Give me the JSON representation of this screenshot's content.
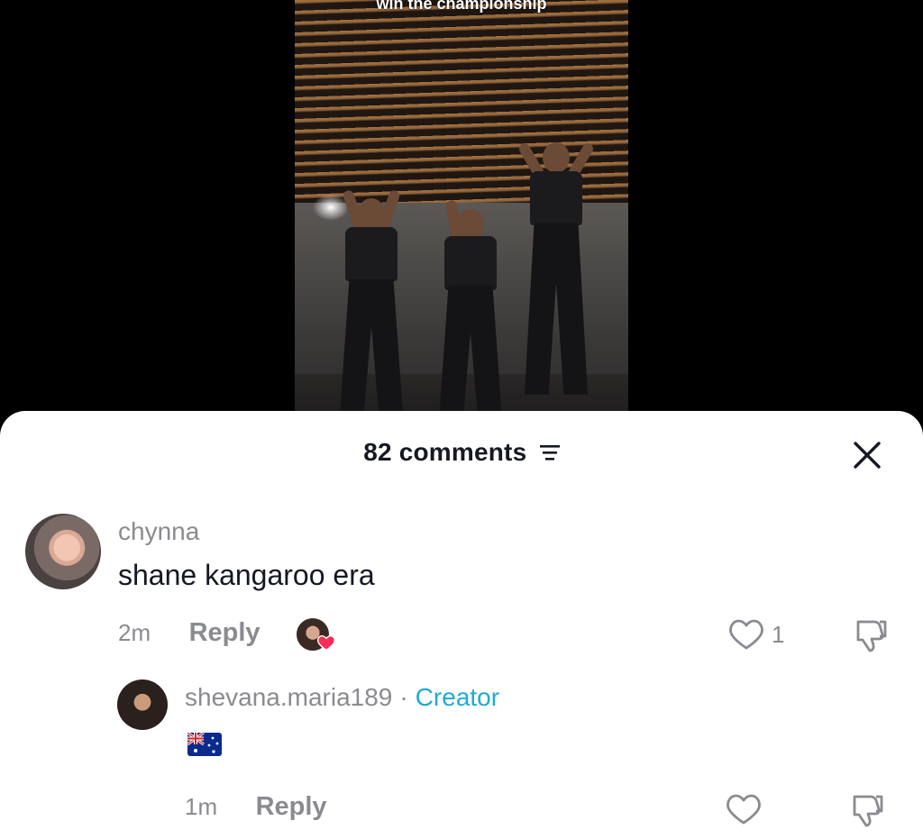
{
  "video": {
    "caption": "win the championship"
  },
  "comments_panel": {
    "count_label": "82 comments",
    "sort_icon": "sort-lines-icon",
    "close_icon": "close-icon"
  },
  "comments": [
    {
      "username": "chynna",
      "text": "shane kangaroo era",
      "time": "2m",
      "reply_label": "Reply",
      "like_count": "1",
      "liked_by_creator": true
    }
  ],
  "replies": [
    {
      "username": "shevana.maria189",
      "separator": "·",
      "badge": "Creator",
      "text_emoji": "🇦🇺",
      "time": "1m",
      "reply_label": "Reply"
    }
  ],
  "colors": {
    "creator_badge": "#20a9d4",
    "heart_red": "#fe2c55",
    "muted_text": "#8a8b91",
    "primary_text": "#161823"
  }
}
